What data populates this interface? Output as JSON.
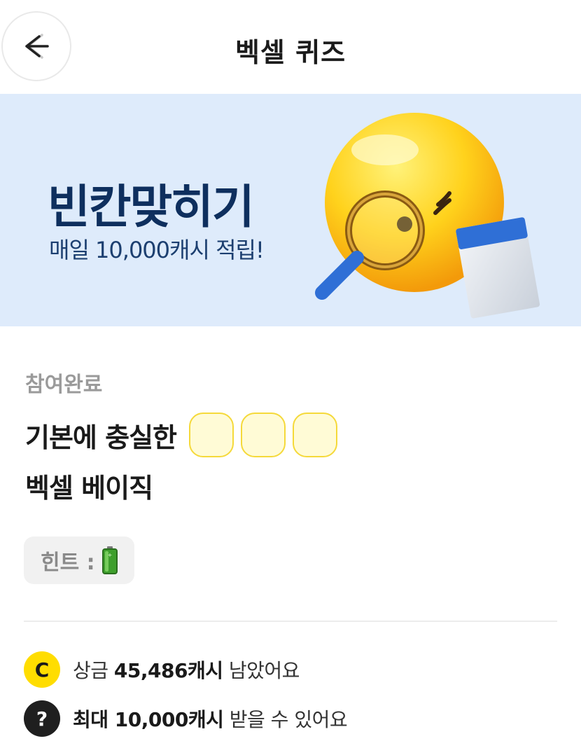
{
  "header": {
    "title": "벡셀 퀴즈"
  },
  "banner": {
    "title": "빈칸맞히기",
    "subtitle": "매일 10,000캐시 적립!"
  },
  "quiz": {
    "status": "참여완료",
    "line1": "기본에 충실한",
    "blank_count": 3,
    "line2": "벡셀 베이직",
    "hint_label": "힌트 :",
    "hint_icon": "battery-icon"
  },
  "info": {
    "prize_prefix": "상금 ",
    "prize_amount": "45,486캐시",
    "prize_suffix": " 남았어요",
    "max_amount": "최대 10,000캐시",
    "max_suffix": " 받을 수 있어요",
    "coin_symbol": "C",
    "question_symbol": "?"
  },
  "colors": {
    "banner_bg": "#deebfb",
    "coin": "#ffdd00",
    "blank_fill": "#fffbd6",
    "blank_border": "#f5d93a"
  }
}
